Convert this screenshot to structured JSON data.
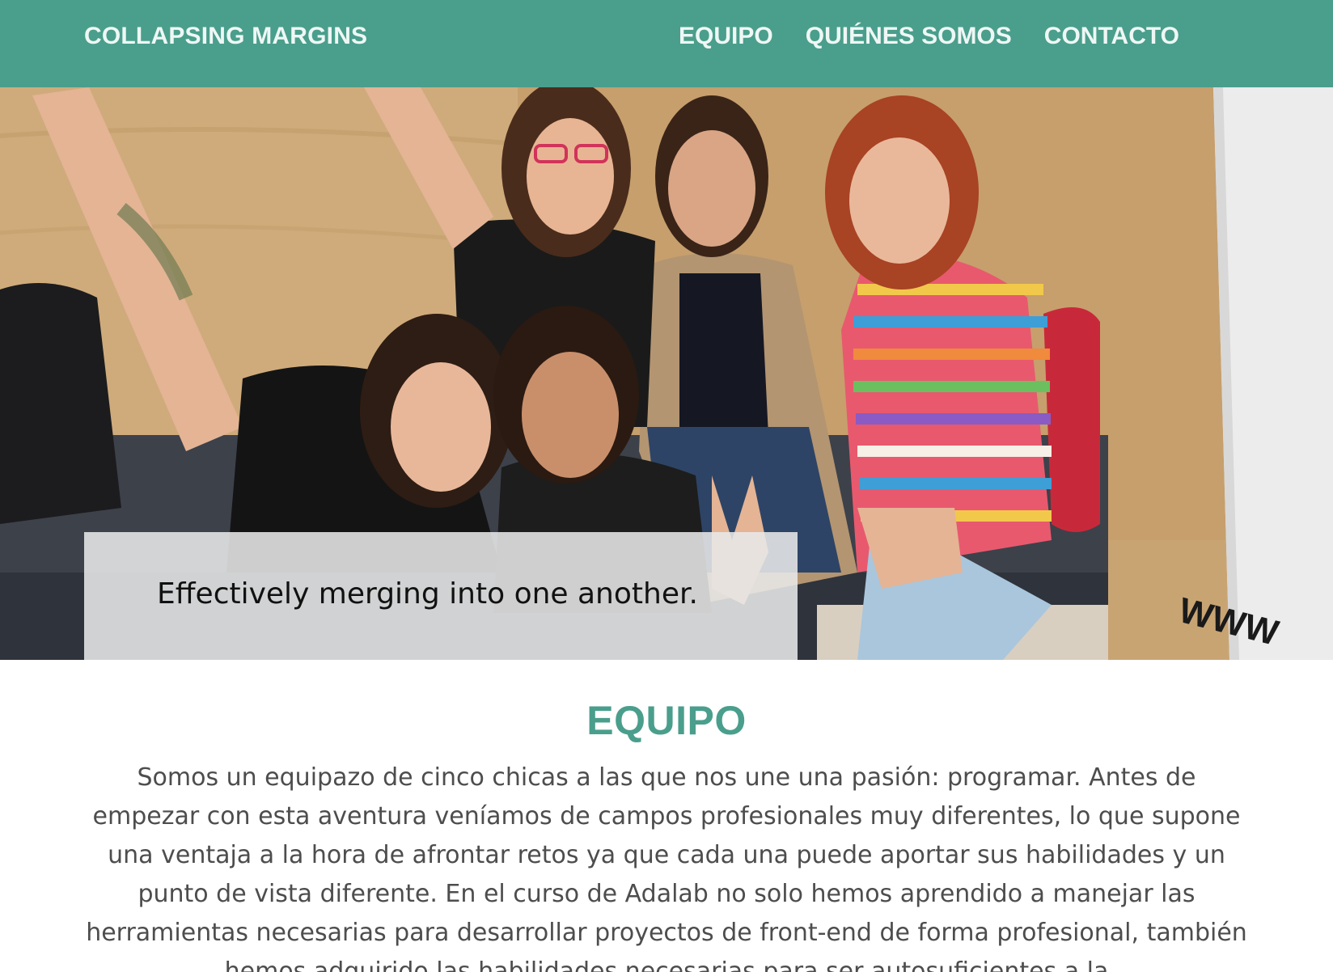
{
  "header": {
    "brand": "COLLAPSING MARGINS",
    "nav": [
      {
        "label": "EQUIPO"
      },
      {
        "label": "QUIÉNES SOMOS"
      },
      {
        "label": "CONTACTO"
      }
    ]
  },
  "hero": {
    "caption": "Effectively merging into one another.",
    "sign_text": "WWW"
  },
  "team_section": {
    "title": "EQUIPO",
    "text": "Somos un equipazo de cinco chicas a las que nos une una pasión: programar. Antes de empezar con esta aventura veníamos de campos profesionales muy diferentes, lo que supone una ventaja a la hora de afrontar retos ya que cada una puede aportar sus habilidades y un punto de vista diferente. En el curso de Adalab no solo hemos aprendido a manejar las herramientas necesarias para desarrollar proyectos de front-end de forma profesional, también hemos adquirido las habilidades necesarias para ser autosuficientes a la"
  },
  "colors": {
    "brand": "#4a9e8c",
    "header_text": "#eef7f4",
    "body_text": "#4d4d4d"
  }
}
